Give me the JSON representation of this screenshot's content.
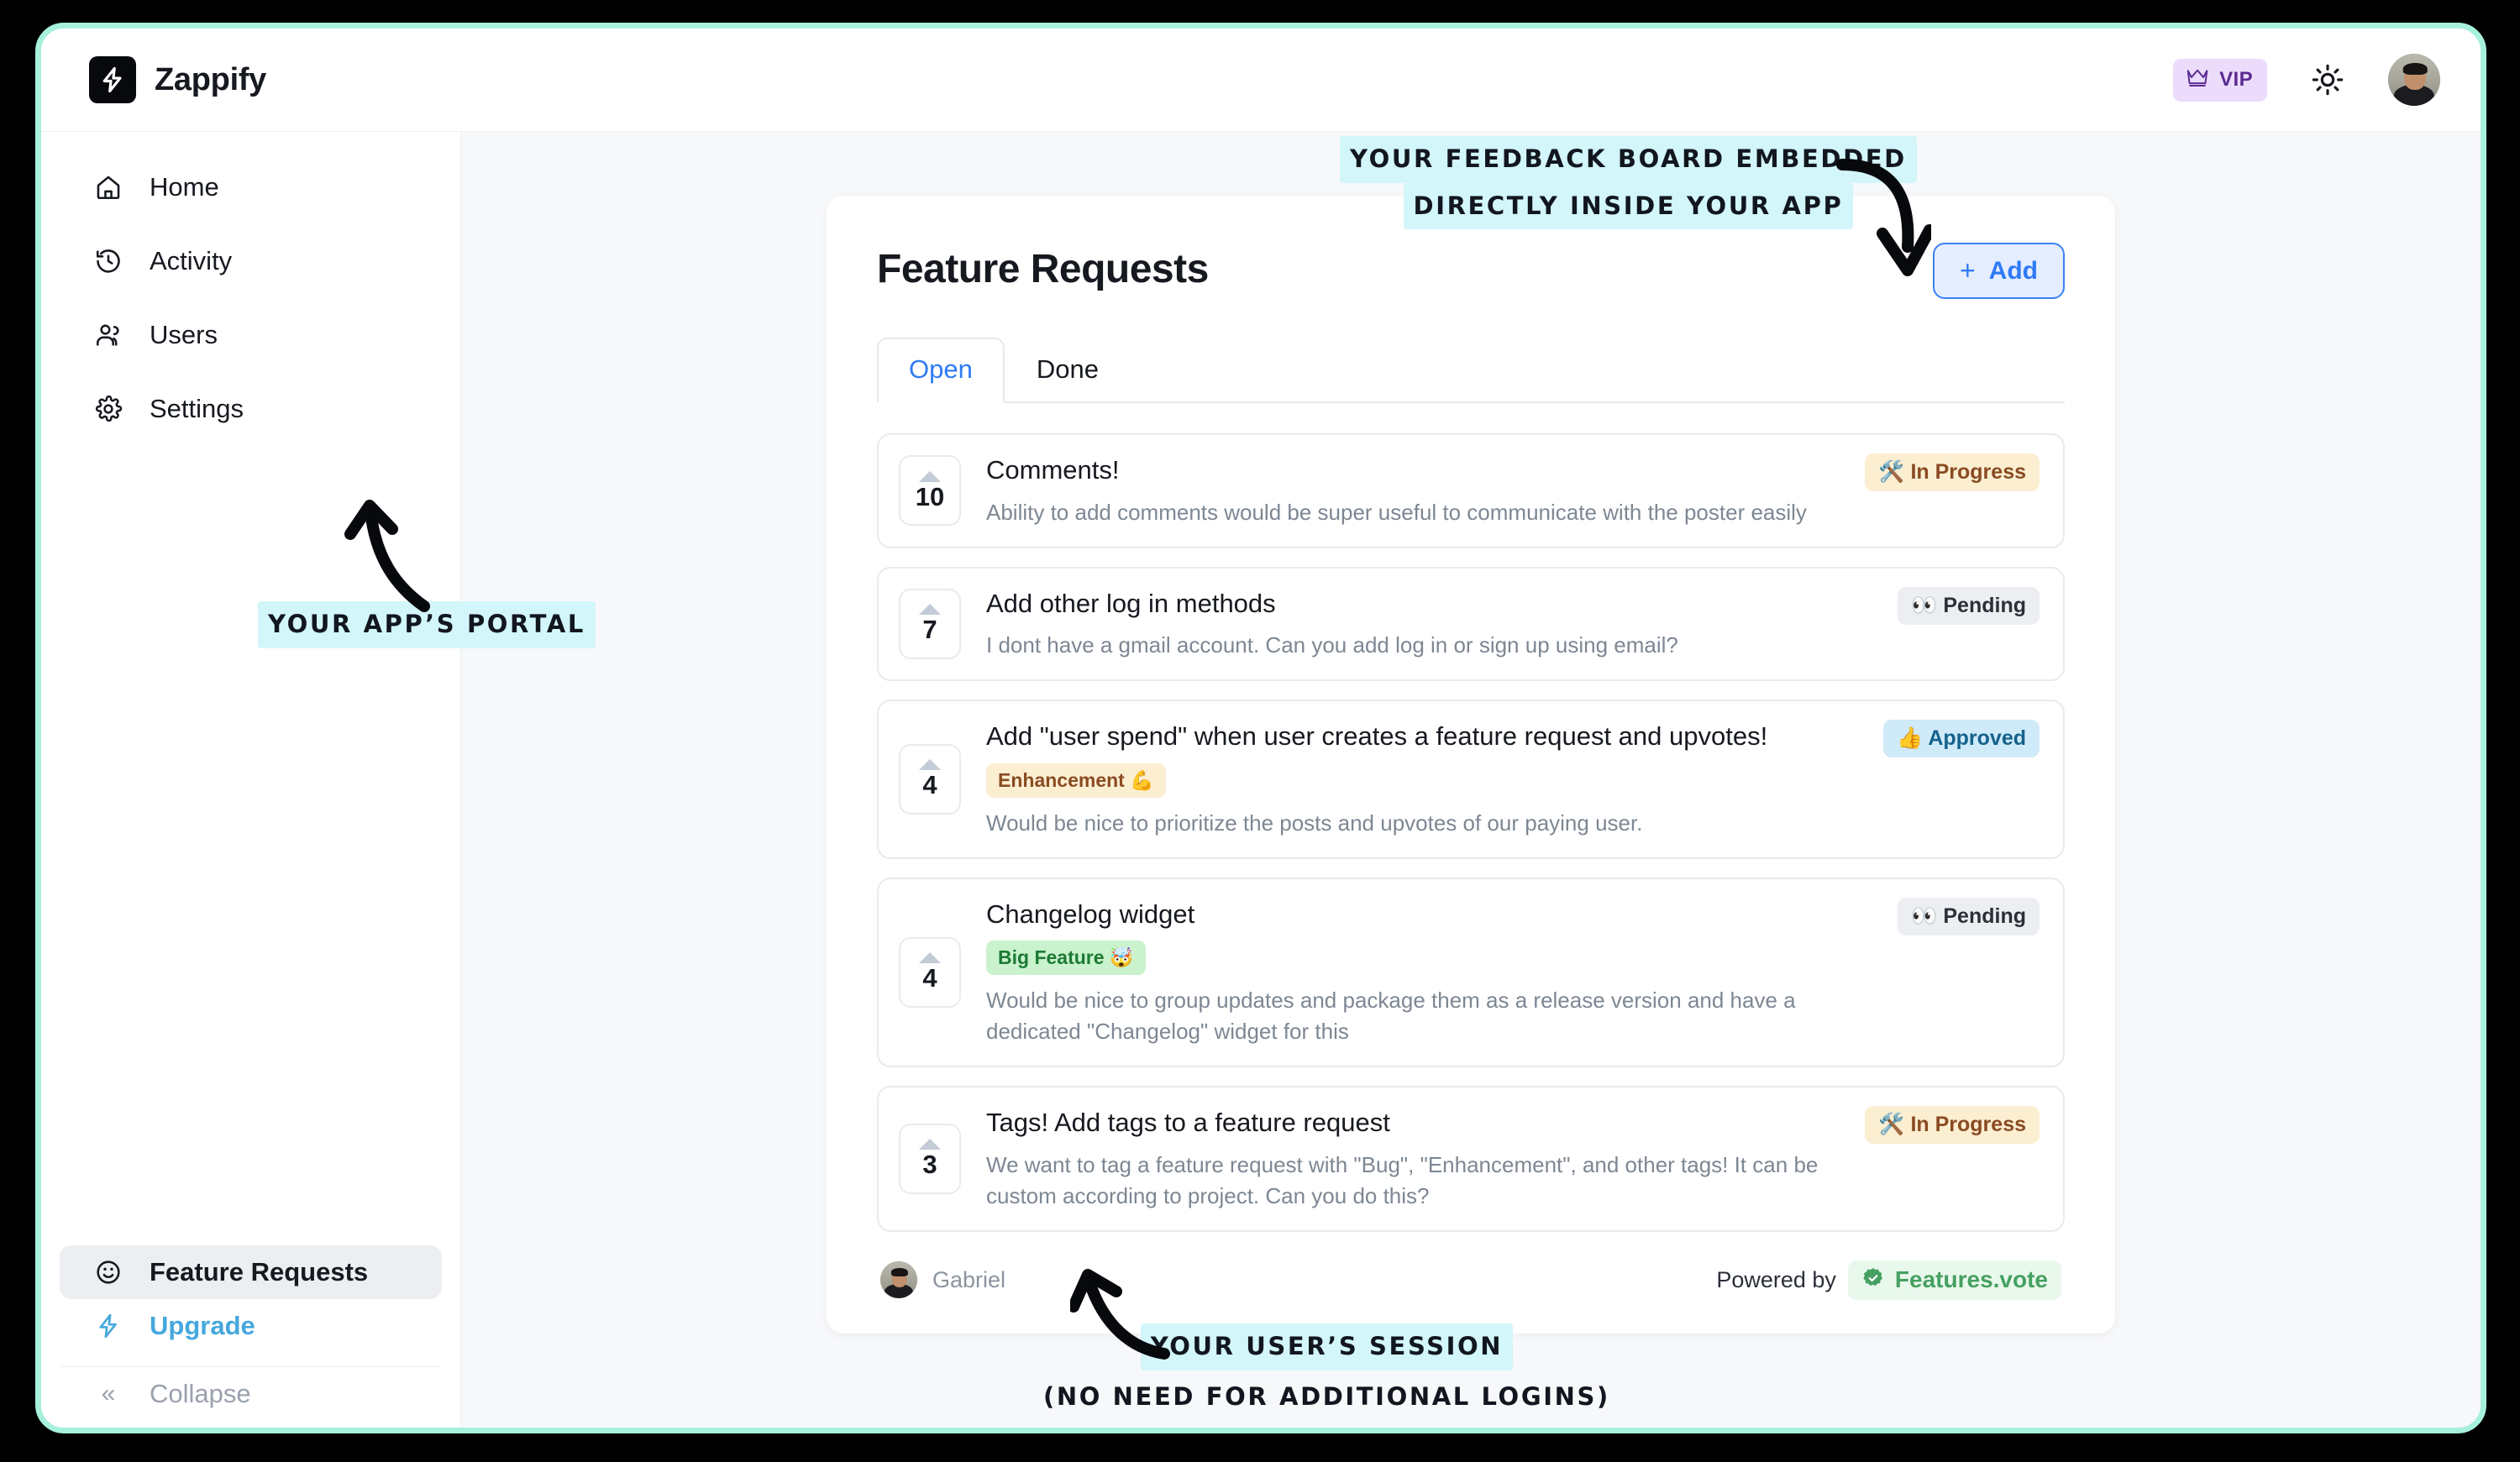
{
  "brand": {
    "name": "Zappify",
    "logo_icon": "lightning-bolt-icon"
  },
  "topbar": {
    "vip_label": "VIP",
    "vip_icon": "crown-icon",
    "theme_icon": "sun-icon",
    "avatar_icon": "user-avatar"
  },
  "sidebar": {
    "items": [
      {
        "label": "Home",
        "icon": "home-icon"
      },
      {
        "label": "Activity",
        "icon": "history-clock-icon"
      },
      {
        "label": "Users",
        "icon": "users-icon"
      },
      {
        "label": "Settings",
        "icon": "gear-icon"
      }
    ],
    "bottom": {
      "feature_requests": {
        "label": "Feature Requests",
        "icon": "smiley-face-icon"
      },
      "upgrade": {
        "label": "Upgrade",
        "icon": "lightning-bolt-icon"
      },
      "collapse": {
        "label": "Collapse",
        "icon": "double-chevron-left-icon"
      }
    }
  },
  "board": {
    "title": "Feature Requests",
    "add_button": {
      "label": "Add",
      "plus": "+"
    },
    "tabs": [
      {
        "label": "Open",
        "active": true
      },
      {
        "label": "Done",
        "active": false
      }
    ],
    "requests": [
      {
        "votes": "10",
        "title": "Comments!",
        "description": "Ability to add comments would be super useful to communicate with the poster easily",
        "status": "🛠️ In Progress",
        "status_kind": "inprogress",
        "tag": null
      },
      {
        "votes": "7",
        "title": "Add other log in methods",
        "description": "I dont have a gmail account. Can you add log in or sign up using email?",
        "status": "👀 Pending",
        "status_kind": "pending",
        "tag": null
      },
      {
        "votes": "4",
        "title": "Add \"user spend\" when user creates a feature request and upvotes!",
        "description": "Would be nice to prioritize the posts and upvotes of our paying user.",
        "status": "👍 Approved",
        "status_kind": "approved",
        "tag": "Enhancement 💪",
        "tag_kind": "enhancement"
      },
      {
        "votes": "4",
        "title": "Changelog widget",
        "description": "Would be nice to group updates and package them as a release version and have a dedicated \"Changelog\" widget for this",
        "status": "👀 Pending",
        "status_kind": "pending",
        "tag": "Big Feature 🤯",
        "tag_kind": "bigfeature"
      },
      {
        "votes": "3",
        "title": "Tags! Add tags to a feature request",
        "description": "We want to tag a feature request with \"Bug\", \"Enhancement\", and other tags! It can be custom according to project. Can you do this?",
        "status": "🛠️ In Progress",
        "status_kind": "inprogress",
        "tag": null
      }
    ],
    "footer": {
      "user_name": "Gabriel",
      "powered_by": "Powered by",
      "provider": "Features.vote",
      "provider_icon": "verified-check-icon"
    }
  },
  "annotations": {
    "top_line1": "YOUR FEEDBACK BOARD EMBEDDED",
    "top_line2": "DIRECTLY INSIDE YOUR APP",
    "portal": "YOUR APP’S PORTAL",
    "session_line1": "YOUR USER’S SESSION",
    "session_line2": "(NO NEED FOR ADDITIONAL LOGINS)"
  },
  "colors": {
    "frame": "#a7f0dc",
    "accent_blue": "#2f7af5",
    "upgrade_blue": "#46a8dc",
    "vip_purple": "#5b2b91",
    "highlight": "#d2f6fa",
    "green": "#46a062"
  }
}
